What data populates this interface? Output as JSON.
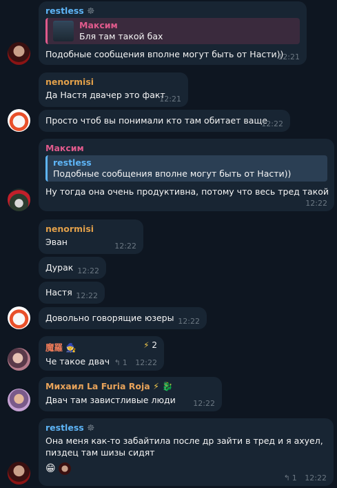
{
  "colors": {
    "restless": "#5eb5f7",
    "nenormisi": "#e2a04a",
    "maxim": "#e05a8c",
    "maro": "#ef7b58",
    "mikhail": "#e8a35a"
  },
  "messages": [
    {
      "author": "restless",
      "author_badge": "☸",
      "quote_author": "Максим",
      "quote_text": "Бля там такой бах",
      "text": "Подобные сообщения вполне могут быть от Насти))",
      "time": "12:21"
    },
    {
      "author": "nenormisi",
      "text": "Да Настя двачер это факт",
      "time": "12:21"
    },
    {
      "text": "Просто чтоб вы понимали кто там обитает ваще",
      "time": "12:22"
    },
    {
      "author": "Максим",
      "quote_author": "restless",
      "quote_text": "Подобные сообщения вполне могут быть от Насти))",
      "text": "Ну тогда она очень продуктивна, потому что весь тред такой",
      "time": "12:22"
    },
    {
      "author": "nenormisi",
      "text": "Эван",
      "time": "12:22"
    },
    {
      "text": "Дурак",
      "time": "12:22"
    },
    {
      "text": "Настя",
      "time": "12:22"
    },
    {
      "text": "Довольно говорящие юзеры",
      "time": "12:22"
    },
    {
      "author": "魔羅",
      "author_badge": "🧙",
      "reaction": "⚡",
      "reaction_count": "2",
      "text": "Че такое двач",
      "replies": "1",
      "time": "12:22"
    },
    {
      "author": "Михаил La Furia Roja",
      "author_badge": "⚡ 🐉",
      "text": "Двач там завистливые люди",
      "time": "12:22"
    },
    {
      "author": "restless",
      "author_badge": "☸",
      "text_line1": "Она меня как-то забайтила после др зайти в тред и я ахуел,",
      "text_line2": "пиздец там шизы сидят",
      "reaction": "😁",
      "replies": "1",
      "time": "12:22"
    }
  ]
}
